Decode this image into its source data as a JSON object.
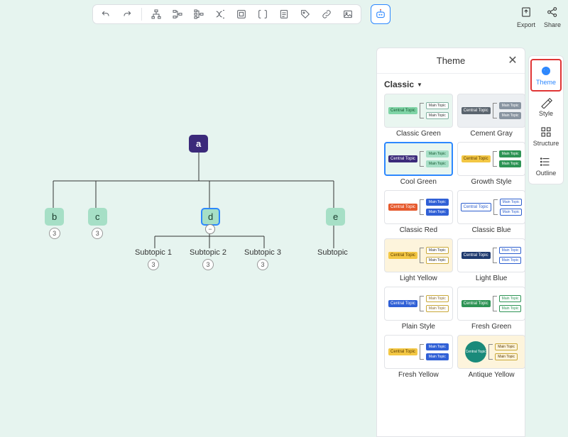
{
  "toolbar": {
    "icons": [
      "undo",
      "redo",
      "layout-tree",
      "layout-org",
      "layout-fish",
      "layout-curve",
      "boundary",
      "brackets",
      "note",
      "tag",
      "link",
      "image"
    ],
    "ai": "ai-robot"
  },
  "corner": {
    "export": "Export",
    "share": "Share"
  },
  "side": {
    "theme": "Theme",
    "style": "Style",
    "structure": "Structure",
    "outline": "Outline"
  },
  "panel": {
    "title": "Theme",
    "category": "Classic",
    "themes": [
      {
        "name": "Classic Green",
        "bg": "bg-green",
        "ct_bg": "#7fd4a6",
        "ct_c": "#14582f",
        "mt_bg": "#ffffff",
        "mt_c": "#333",
        "mt_b": "#7fb1a0"
      },
      {
        "name": "Cement Gray",
        "bg": "bg-gray",
        "ct_bg": "#5a646e",
        "ct_c": "#fff",
        "mt_bg": "#8894a0",
        "mt_c": "#fff",
        "mt_b": "#8894a0"
      },
      {
        "name": "Cool Green",
        "bg": "bg-green",
        "ct_bg": "#3b2a7a",
        "ct_c": "#fff",
        "mt_bg": "#a6dfc6",
        "mt_c": "#14582f",
        "mt_b": "#a6dfc6",
        "selected": true
      },
      {
        "name": "Growth Style",
        "bg": "bg-plain",
        "ct_bg": "#f3c744",
        "ct_c": "#5a3a00",
        "mt_bg": "#2e9455",
        "mt_c": "#fff",
        "mt_b": "#2e9455"
      },
      {
        "name": "Classic Red",
        "bg": "bg-plain",
        "ct_bg": "#e65a2e",
        "ct_c": "#fff",
        "mt_bg": "#3060d6",
        "mt_c": "#fff",
        "mt_b": "#3060d6"
      },
      {
        "name": "Classic Blue",
        "bg": "bg-plain",
        "ct_bg": "#ffffff",
        "ct_c": "#2d5fce",
        "mt_bg": "#ffffff",
        "mt_c": "#2d5fce",
        "mt_b": "#2d5fce",
        "ct_b": "#2d5fce"
      },
      {
        "name": "Light Yellow",
        "bg": "bg-yellow",
        "ct_bg": "#f3c744",
        "ct_c": "#5a3a00",
        "mt_bg": "#ffffff",
        "mt_c": "#333",
        "mt_b": "#c9a838"
      },
      {
        "name": "Light Blue",
        "bg": "bg-plain",
        "ct_bg": "#1f3a6e",
        "ct_c": "#fff",
        "mt_bg": "#ffffff",
        "mt_c": "#2d5fce",
        "mt_b": "#2d5fce"
      },
      {
        "name": "Plain Style",
        "bg": "bg-plain",
        "ct_bg": "#3060d6",
        "ct_c": "#fff",
        "mt_bg": "#ffffff",
        "mt_c": "#8a6b2e",
        "mt_b": "#c9a838"
      },
      {
        "name": "Fresh Green",
        "bg": "bg-plain",
        "ct_bg": "#2e9455",
        "ct_c": "#fff",
        "mt_bg": "#ffffff",
        "mt_c": "#2e9455",
        "mt_b": "#2e9455"
      },
      {
        "name": "Fresh Yellow",
        "bg": "bg-plain",
        "ct_bg": "#f3c744",
        "ct_c": "#5a3a00",
        "mt_bg": "#3060d6",
        "mt_c": "#fff",
        "mt_b": "#3060d6"
      },
      {
        "name": "Antique Yellow",
        "bg": "bg-yellow",
        "ct_bg": "#1a8a7a",
        "ct_c": "#fff",
        "mt_bg": "#fdf4dc",
        "mt_c": "#5a3a00",
        "mt_b": "#c9a838",
        "round": true
      }
    ],
    "ct_text": "Central Topic",
    "mt_text": "Main Topic"
  },
  "map": {
    "root": "a",
    "children": [
      {
        "label": "b",
        "badge": "3"
      },
      {
        "label": "c",
        "badge": "3"
      },
      {
        "label": "d",
        "selected": true,
        "children": [
          {
            "label": "Subtopic 1",
            "badge": "3"
          },
          {
            "label": "Subtopic 2",
            "badge": "3"
          },
          {
            "label": "Subtopic 3",
            "badge": "3"
          }
        ]
      },
      {
        "label": "e",
        "children": [
          {
            "label": "Subtopic"
          }
        ]
      }
    ]
  }
}
